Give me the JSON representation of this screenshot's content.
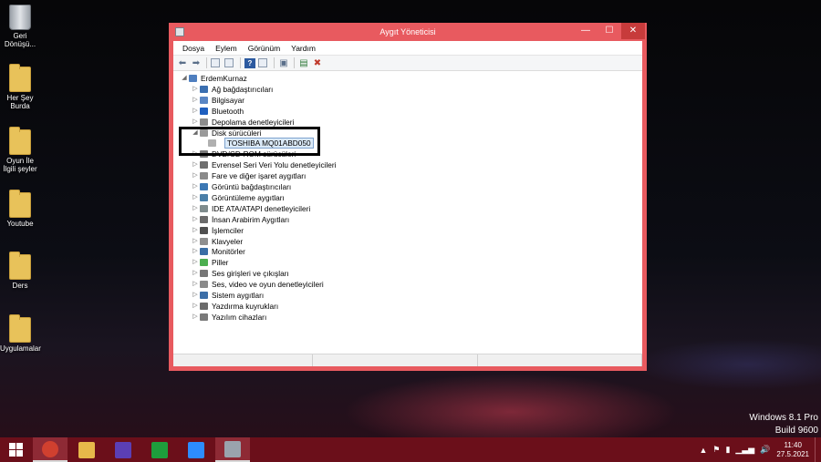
{
  "desktop": {
    "icons": [
      {
        "label": "Geri Dönüşü...",
        "kind": "bin"
      },
      {
        "label": "Her Şey Burda",
        "kind": "folder"
      },
      {
        "label": "Oyun İle İlgili şeyler",
        "kind": "folder"
      },
      {
        "label": "Youtube",
        "kind": "folder"
      },
      {
        "label": "Ders",
        "kind": "folder"
      },
      {
        "label": "Uygulamalar",
        "kind": "folder"
      }
    ],
    "watermark": {
      "line1": "Windows 8.1 Pro",
      "line2": "Build 9600"
    }
  },
  "window": {
    "title": "Aygıt Yöneticisi",
    "controls": {
      "minimize": "—",
      "maximize": "☐",
      "close": "✕"
    },
    "menu": [
      "Dosya",
      "Eylem",
      "Görünüm",
      "Yardım"
    ],
    "toolbar_icons": [
      "back-icon",
      "forward-icon",
      "properties-icon",
      "show-hidden-icon",
      "help-icon",
      "view-icon",
      "update-driver-icon",
      "scan-hardware-icon",
      "uninstall-icon"
    ],
    "tree": {
      "root": "ErdemKurnaz",
      "root_expander": "◢",
      "categories": [
        {
          "label": "Ağ bağdaştırıcıları",
          "expanded": false,
          "color": "#3b6fb0"
        },
        {
          "label": "Bilgisayar",
          "expanded": false,
          "color": "#5a86c4"
        },
        {
          "label": "Bluetooth",
          "expanded": false,
          "color": "#1f5fbf"
        },
        {
          "label": "Depolama denetleyicileri",
          "expanded": false,
          "color": "#8c8c8c"
        },
        {
          "label": "Disk sürücüleri",
          "expanded": true,
          "color": "#9a9a9a",
          "children": [
            "TOSHIBA MQ01ABD050"
          ]
        },
        {
          "label": "DVD/CD-ROM sürücüleri",
          "expanded": false,
          "color": "#7a7a7a"
        },
        {
          "label": "Evrensel Seri Veri Yolu denetleyicileri",
          "expanded": false,
          "color": "#6f6f6f"
        },
        {
          "label": "Fare ve diğer işaret aygıtları",
          "expanded": false,
          "color": "#8a8a8a"
        },
        {
          "label": "Görüntü bağdaştırıcıları",
          "expanded": false,
          "color": "#3c78b4"
        },
        {
          "label": "Görüntüleme aygıtları",
          "expanded": false,
          "color": "#4a7fa8"
        },
        {
          "label": "IDE ATA/ATAPI denetleyicileri",
          "expanded": false,
          "color": "#7f8c8d"
        },
        {
          "label": "İnsan Arabirim Aygıtları",
          "expanded": false,
          "color": "#6b6b6b"
        },
        {
          "label": "İşlemciler",
          "expanded": false,
          "color": "#4f4f4f"
        },
        {
          "label": "Klavyeler",
          "expanded": false,
          "color": "#8f8f8f"
        },
        {
          "label": "Monitörler",
          "expanded": false,
          "color": "#3a6ea5"
        },
        {
          "label": "Piller",
          "expanded": false,
          "color": "#4caf50"
        },
        {
          "label": "Ses girişleri ve çıkışları",
          "expanded": false,
          "color": "#777777"
        },
        {
          "label": "Ses, video ve oyun denetleyicileri",
          "expanded": false,
          "color": "#8a8a8a"
        },
        {
          "label": "Sistem aygıtları",
          "expanded": false,
          "color": "#3d6fa8"
        },
        {
          "label": "Yazdırma kuyrukları",
          "expanded": false,
          "color": "#6b6b6b"
        },
        {
          "label": "Yazılım cihazları",
          "expanded": false,
          "color": "#7a7a7a"
        }
      ],
      "collapsed_glyph": "▷",
      "expanded_glyph": "◢"
    }
  },
  "taskbar": {
    "apps": [
      {
        "name": "chrome",
        "color": "#d0402f",
        "active": true
      },
      {
        "name": "file-explorer",
        "color": "#e7b84a",
        "active": false
      },
      {
        "name": "settings",
        "color": "#5b3fb5",
        "active": false
      },
      {
        "name": "store",
        "color": "#1e9e3c",
        "active": false
      },
      {
        "name": "zoom",
        "color": "#2d8cff",
        "active": false
      },
      {
        "name": "device-manager",
        "color": "#9aa3ad",
        "active": true
      }
    ],
    "tray": {
      "time": "11:40",
      "date": "27.5.2021"
    }
  },
  "accent": "#e85a5f"
}
